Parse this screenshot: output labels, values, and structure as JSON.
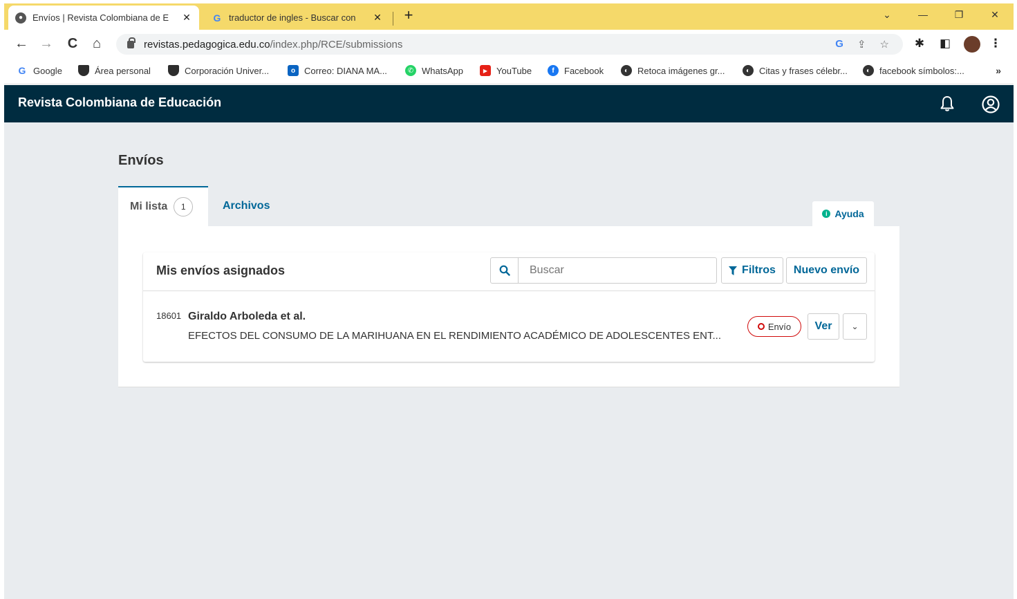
{
  "browser": {
    "tabs": [
      {
        "title": "Envíos | Revista Colombiana de E",
        "active": true
      },
      {
        "title": "traductor de ingles - Buscar con",
        "active": false
      }
    ],
    "url_host": "revistas.pedagogica.edu.co",
    "url_path": "/index.php/RCE/submissions",
    "bookmarks": [
      {
        "label": "Google",
        "icon": "google-icon"
      },
      {
        "label": "Área personal",
        "icon": "shield-bookmark-icon"
      },
      {
        "label": "Corporación Univer...",
        "icon": "shield-bookmark-icon"
      },
      {
        "label": "Correo: DIANA MA...",
        "icon": "outlook-icon"
      },
      {
        "label": "WhatsApp",
        "icon": "whatsapp-icon"
      },
      {
        "label": "YouTube",
        "icon": "youtube-icon"
      },
      {
        "label": "Facebook",
        "icon": "facebook-icon"
      },
      {
        "label": "Retoca imágenes gr...",
        "icon": "globe-icon"
      },
      {
        "label": "Citas y frases célebr...",
        "icon": "globe-icon"
      },
      {
        "label": "facebook símbolos:...",
        "icon": "globe-icon"
      }
    ],
    "bookmarks_more": "»"
  },
  "app": {
    "brand": "Revista Colombiana de Educación"
  },
  "page": {
    "title": "Envíos",
    "tabs": {
      "mine_label": "Mi lista",
      "mine_count": "1",
      "archive_label": "Archivos"
    },
    "help_label": "Ayuda",
    "list": {
      "title": "Mis envíos asignados",
      "search_placeholder": "Buscar",
      "filters_label": "Filtros",
      "new_label": "Nuevo envío",
      "items": [
        {
          "id": "18601",
          "authors": "Giraldo Arboleda et al.",
          "title": "EFECTOS DEL CONSUMO DE LA MARIHUANA EN EL RENDIMIENTO ACADÉMICO DE ADOLESCENTES ENT...",
          "stage": "Envío",
          "view_label": "Ver"
        }
      ]
    }
  },
  "colors": {
    "tabstrip": "#f5d96a",
    "header": "#002c40",
    "page_bg": "#e9ecef",
    "link": "#006798",
    "stage": "#d00a0a"
  }
}
